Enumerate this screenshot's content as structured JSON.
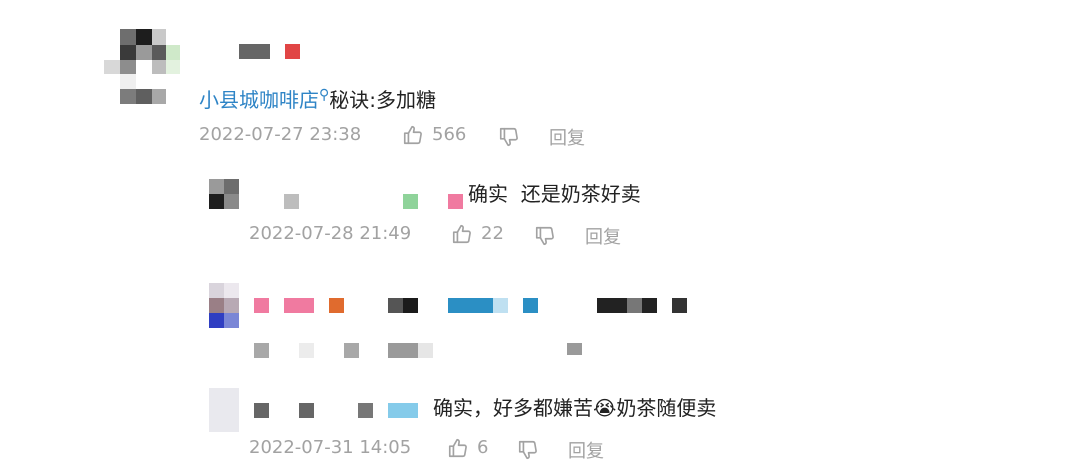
{
  "comments": [
    {
      "mention": "小县城咖啡店",
      "text": "秘诀:多加糖",
      "time": "2022-07-27 23:38",
      "likes": "566",
      "reply_label": "回复"
    },
    {
      "text": "确实  还是奶茶好卖",
      "time": "2022-07-28 21:49",
      "likes": "22",
      "reply_label": "回复"
    },
    {
      "text": "",
      "time": "",
      "likes": "",
      "reply_label": ""
    },
    {
      "text": "确实，好多都嫌苦😭奶茶随便卖",
      "time": "2022-07-31 14:05",
      "likes": "6",
      "reply_label": "回复"
    }
  ],
  "icons": {
    "like": "thumbs-up-icon",
    "dislike": "thumbs-down-icon",
    "search": "search-icon"
  },
  "colors": {
    "mention": "#2e84c6",
    "meta": "#a2a2a2"
  }
}
